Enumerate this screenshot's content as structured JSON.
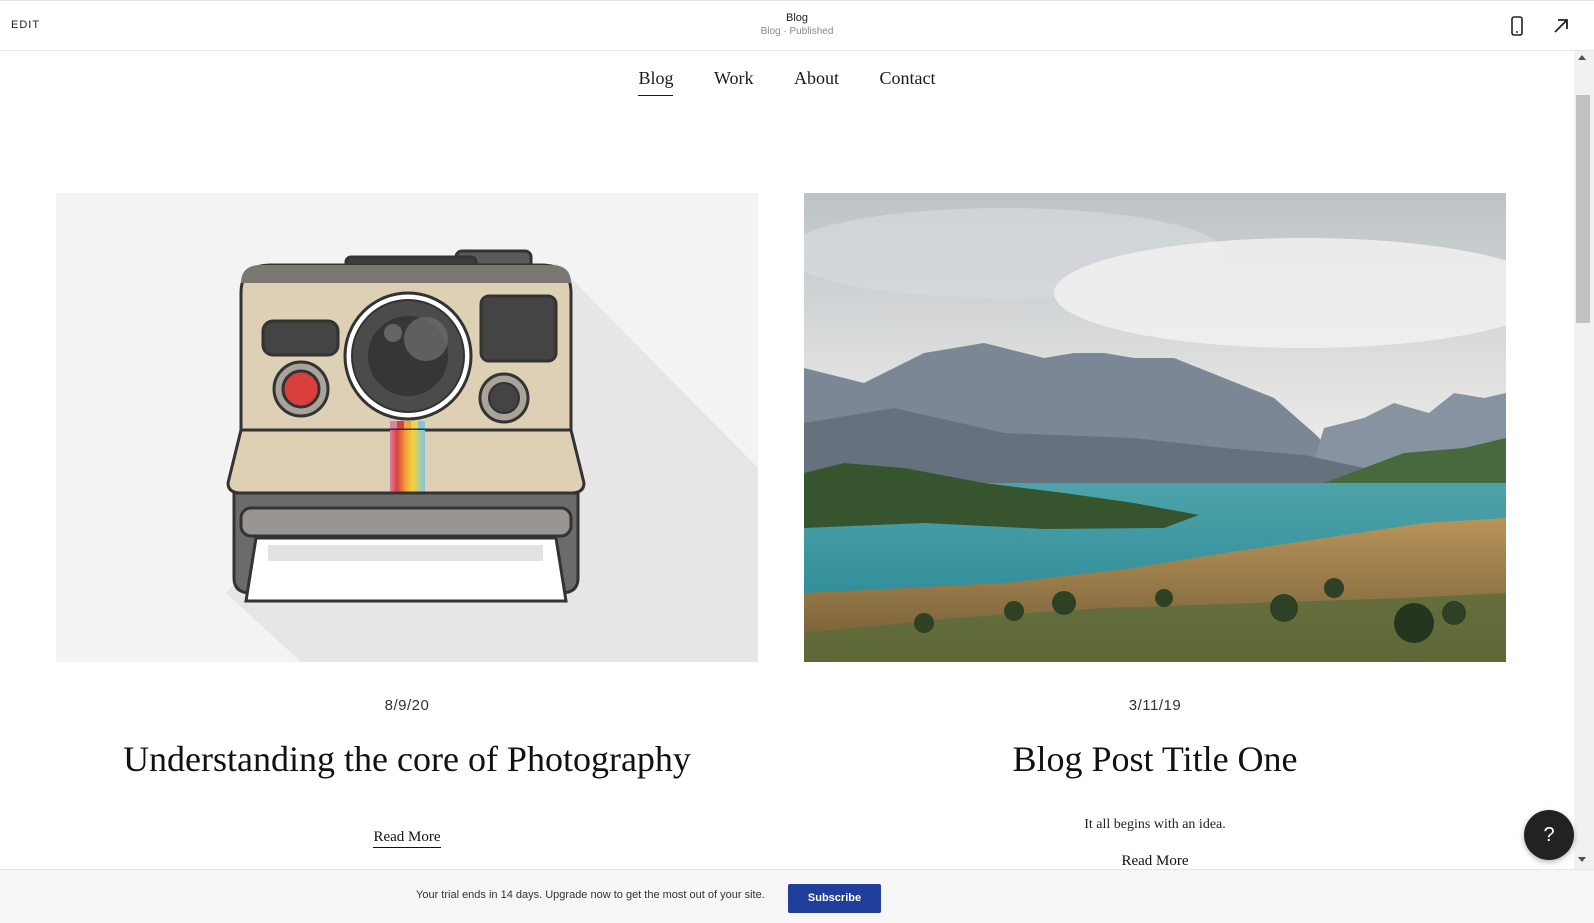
{
  "topbar": {
    "edit_label": "EDIT",
    "page_title": "Blog",
    "page_status": "Blog · Published"
  },
  "nav": {
    "items": [
      {
        "label": "Blog",
        "active": true
      },
      {
        "label": "Work",
        "active": false
      },
      {
        "label": "About",
        "active": false
      },
      {
        "label": "Contact",
        "active": false
      }
    ]
  },
  "posts": [
    {
      "date": "8/9/20",
      "title": "Understanding the core of Photography",
      "excerpt": "",
      "read_more": "Read More",
      "image": "polaroid-camera-illustration"
    },
    {
      "date": "3/11/19",
      "title": "Blog Post Title One",
      "excerpt": "It all begins with an idea.",
      "read_more": "Read More",
      "image": "mountain-lake-photo"
    }
  ],
  "help": {
    "label": "?"
  },
  "trial": {
    "message": "Your trial ends in 14 days. Upgrade now to get the most out of your site.",
    "subscribe_label": "Subscribe"
  },
  "colors": {
    "accent": "#1f3f9b",
    "help_bg": "#222222"
  },
  "icons": {
    "mobile": "mobile-phone-icon",
    "open": "arrow-up-right-icon"
  }
}
